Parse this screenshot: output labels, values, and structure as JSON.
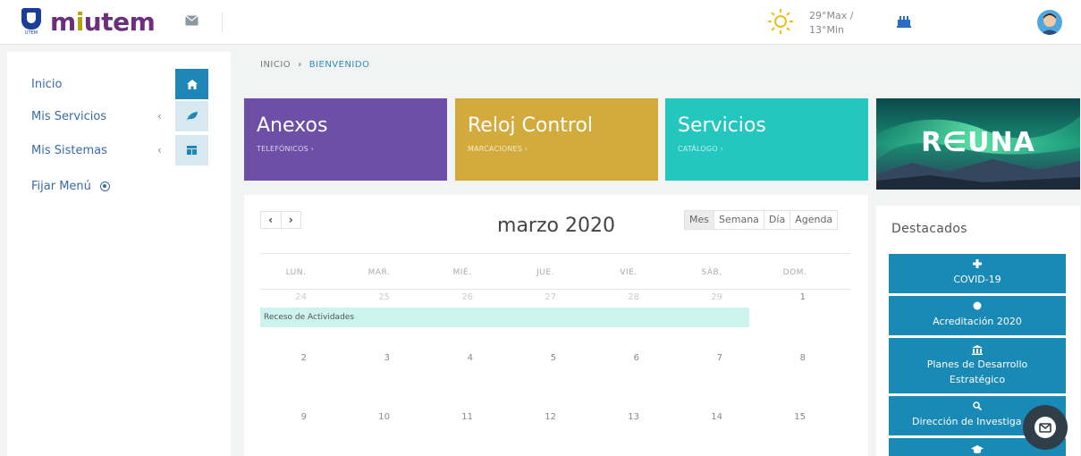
{
  "header": {
    "logo_badge_text": "UTEM",
    "logo_text_pre": "m",
    "logo_text_i": "i",
    "logo_text_post": "utem",
    "weather_max": "29°Max /",
    "weather_min": "13°Min",
    "icons": [
      "mail-icon",
      "sun-icon",
      "building-icon",
      "avatar"
    ]
  },
  "sidebar": {
    "items": [
      {
        "label": "Inicio",
        "icon": "home-icon"
      },
      {
        "label": "Mis Servicios",
        "chevron": "‹",
        "icon": "leaf-icon"
      },
      {
        "label": "Mis Sistemas",
        "chevron": "‹",
        "icon": "layout-icon"
      }
    ],
    "fix_menu": "Fijar Menú"
  },
  "breadcrumb": {
    "root": "INICIO",
    "sep": "›",
    "current": "BIENVENIDO"
  },
  "tiles": [
    {
      "title": "Anexos",
      "sub": "TELEFÓNICOS ›",
      "color": "#6d4fa8"
    },
    {
      "title": "Reloj Control",
      "sub": "MARCACIONES ›",
      "color": "#d3aa3c"
    },
    {
      "title": "Servicios",
      "sub": "CATÁLOGO ›",
      "color": "#23c7bd"
    }
  ],
  "banner": {
    "text": "R∈UNA"
  },
  "calendar": {
    "prev": "‹",
    "next": "›",
    "title": "marzo 2020",
    "views": [
      "Mes",
      "Semana",
      "Día",
      "Agenda"
    ],
    "weekdays": [
      "LUN.",
      "MAR.",
      "MIÉ.",
      "JUE.",
      "VIE.",
      "SÁB.",
      "DOM."
    ],
    "weeks": [
      [
        {
          "d": "24",
          "other": true
        },
        {
          "d": "25",
          "other": true
        },
        {
          "d": "26",
          "other": true
        },
        {
          "d": "27",
          "other": true
        },
        {
          "d": "28",
          "other": true
        },
        {
          "d": "29",
          "other": true
        },
        {
          "d": "1",
          "other": false
        }
      ],
      [
        {
          "d": "2",
          "other": false
        },
        {
          "d": "3",
          "other": false
        },
        {
          "d": "4",
          "other": false
        },
        {
          "d": "5",
          "other": false
        },
        {
          "d": "6",
          "other": false
        },
        {
          "d": "7",
          "other": false
        },
        {
          "d": "8",
          "other": false
        }
      ],
      [
        {
          "d": "9",
          "other": false
        },
        {
          "d": "10",
          "other": false
        },
        {
          "d": "11",
          "other": false
        },
        {
          "d": "12",
          "other": false
        },
        {
          "d": "13",
          "other": false
        },
        {
          "d": "14",
          "other": false
        },
        {
          "d": "15",
          "other": false
        }
      ]
    ],
    "event": "Receso de Actividades"
  },
  "destacados": {
    "title": "Destacados",
    "buttons": [
      {
        "label": "COVID-19",
        "icon": "plus-icon"
      },
      {
        "label": "Acreditación 2020",
        "icon": "badge-icon"
      },
      {
        "label": "Planes de Desarrollo Estratégico",
        "icon": "institution-icon"
      },
      {
        "label": "Dirección de Investiga",
        "icon": "search-icon"
      },
      {
        "label": "",
        "icon": "graduation-cap-icon"
      }
    ]
  },
  "chat": {
    "icon": "chat-mail-icon"
  },
  "colors": {
    "primary": "#1e87b8",
    "nav_text": "#3a6aa5",
    "event_bg": "#cdf3ef"
  }
}
